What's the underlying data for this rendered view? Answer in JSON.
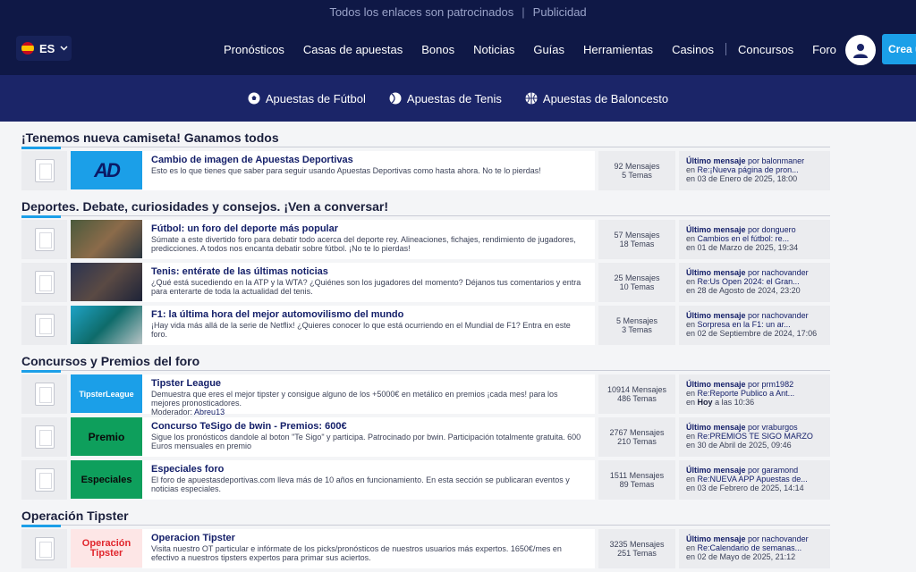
{
  "topbar": {
    "notice": "Todos los enlaces son patrocinados",
    "separator": "|",
    "ad": "Publicidad"
  },
  "lang": {
    "code": "ES"
  },
  "menu": {
    "items": [
      "Pronósticos",
      "Casas de apuestas",
      "Bonos",
      "Noticias",
      "Guías",
      "Herramientas",
      "Casinos"
    ],
    "after_sep": [
      "Concursos",
      "Foro"
    ],
    "cta": "Crea u"
  },
  "subnav": {
    "items": [
      "Apuestas de Fútbol",
      "Apuestas de Tenis",
      "Apuestas de Baloncesto"
    ]
  },
  "sections": [
    {
      "title": "¡Tenemos nueva camiseta! Ganamos todos",
      "rows": [
        {
          "thumb": "AD",
          "title": "Cambio de imagen de Apuestas Deportivas",
          "desc": "Esto es lo que tienes que saber para seguir usando Apuestas Deportivas como hasta ahora. No te lo pierdas!",
          "posts": "92 Mensajes",
          "topics": "5 Temas",
          "last_label": "Último mensaje",
          "last_by": "por balonmaner",
          "last_in": "en",
          "last_topic": "Re:¡Nueva página de pron...",
          "last_date": "en 03 de Enero de 2025, 18:00"
        }
      ]
    },
    {
      "title": "Deportes. Debate, curiosidades y consejos. ¡Ven a conversar!",
      "rows": [
        {
          "title": "Fútbol: un foro del deporte más popular",
          "desc": "Súmate a este divertido foro para debatir todo acerca del deporte rey. Alineaciones, fichajes, rendimiento de jugadores, predicciones. A todos nos encanta debatir sobre fútbol. ¡No te lo pierdas!",
          "posts": "57 Mensajes",
          "topics": "18 Temas",
          "last_label": "Último mensaje",
          "last_by": "por donguero",
          "last_in": "en",
          "last_topic": "Cambios en el fútbol: re...",
          "last_date": "en 01 de Marzo de 2025, 19:34"
        },
        {
          "title": "Tenis: entérate de las últimas noticias",
          "desc": "¿Qué está sucediendo en la ATP y la WTA? ¿Quiénes son los jugadores del momento? Déjanos tus comentarios y entra para enterarte de toda la actualidad del tenis.",
          "posts": "25 Mensajes",
          "topics": "10 Temas",
          "last_label": "Último mensaje",
          "last_by": "por nachovander",
          "last_in": "en",
          "last_topic": "Re:Us Open 2024: el Gran...",
          "last_date": "en 28 de Agosto de 2024, 23:20"
        },
        {
          "title": "F1: la última hora del mejor automovilismo del mundo",
          "desc": "¡Hay vida más allá de la serie de Netflix! ¿Quieres conocer lo que está ocurriendo en el Mundial de F1? Entra en este foro.",
          "posts": "5 Mensajes",
          "topics": "3 Temas",
          "last_label": "Último mensaje",
          "last_by": "por nachovander",
          "last_in": "en",
          "last_topic": "Sorpresa en la F1: un ar...",
          "last_date": "en 02 de Septiembre de 2024, 17:06"
        }
      ]
    },
    {
      "title": "Concursos y Premios del foro",
      "rows": [
        {
          "thumb": "TipsterLeague",
          "title": "Tipster League",
          "desc": "Demuestra que eres el mejor tipster y consigue alguno de los +5000€ en metálico en premios ¡cada mes! para los mejores pronosticadores.",
          "mod_label": "Moderador:",
          "mod_name": "Abreu13",
          "posts": "10914 Mensajes",
          "topics": "486 Temas",
          "last_label": "Último mensaje",
          "last_by": "por prm1982",
          "last_in": "en",
          "last_topic": "Re:Reporte Publico a Ant...",
          "last_date_pre": "en",
          "last_date_bold": "Hoy",
          "last_date_post": "a las 10:36"
        },
        {
          "thumb": "Premio",
          "title": "Concurso TeSigo de bwin - Premios: 600€",
          "desc": "Sigue los pronósticos dandole al boton \"Te Sigo\" y participa. Patrocinado por bwin. Participación totalmente gratuita. 600 Euros mensuales en premio",
          "posts": "2767 Mensajes",
          "topics": "210 Temas",
          "last_label": "Último mensaje",
          "last_by": "por vraburgos",
          "last_in": "en",
          "last_topic": "Re:PREMIOS TE SIGO MARZO",
          "last_date": "en 30 de Abril de 2025, 09:46"
        },
        {
          "thumb": "Especiales",
          "title": "Especiales foro",
          "desc": "El foro de apuestasdeportivas.com lleva más de 10 años en funcionamiento. En esta sección se publicaran eventos y noticias especiales.",
          "posts": "1511 Mensajes",
          "topics": "89 Temas",
          "last_label": "Último mensaje",
          "last_by": "por garamond",
          "last_in": "en",
          "last_topic": "Re:NUEVA APP Apuestas de...",
          "last_date": "en 03 de Febrero de 2025, 14:14"
        }
      ]
    },
    {
      "title": "Operación Tipster",
      "rows": [
        {
          "thumb_l1": "Operación",
          "thumb_l2": "Tipster",
          "title": "Operacion Tipster",
          "desc": "Visita nuestro OT particular e infórmate de los picks/pronósticos de nuestros usuarios más expertos. 1650€/mes en efectivo a nuestros tipsters expertos para primar sus aciertos.",
          "posts": "3235 Mensajes",
          "topics": "251 Temas",
          "last_label": "Último mensaje",
          "last_by": "por nachovander",
          "last_in": "en",
          "last_topic": "Re:Calendario de semanas...",
          "last_date": "en 02 de Mayo de 2025, 21:12"
        }
      ]
    }
  ]
}
